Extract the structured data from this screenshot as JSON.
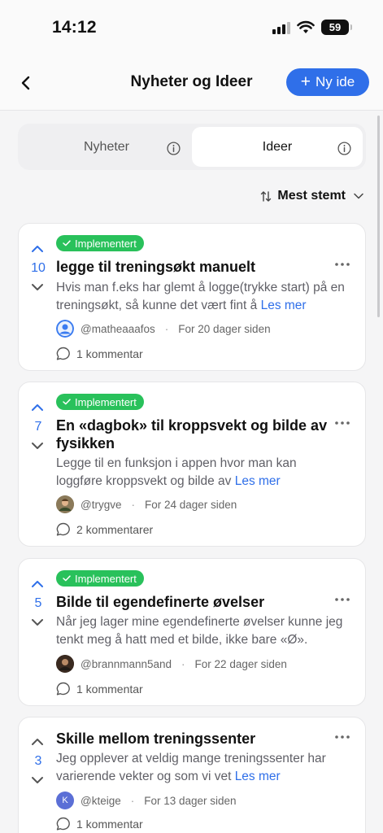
{
  "status": {
    "time": "14:12",
    "battery": "59"
  },
  "nav": {
    "title": "Nyheter og Ideer",
    "new_button": "Ny ide"
  },
  "tabs": [
    {
      "label": "Nyheter"
    },
    {
      "label": "Ideer"
    }
  ],
  "sort": {
    "label": "Mest stemt"
  },
  "badge": {
    "label": "Implementert",
    "color": "#29c15b"
  },
  "accent": "#2f6fe9",
  "read_more": "Les mer",
  "ideas": [
    {
      "votes": "10",
      "implemented": true,
      "title": "legge til treningsøkt manuelt",
      "description": "Hvis man f.eks har glemt å logge(trykke start) på en treningsøkt, så kunne det vært fint å",
      "author": "@matheaaafos",
      "time": "For 20 dager siden",
      "comments": "1 kommentar"
    },
    {
      "votes": "7",
      "implemented": true,
      "title": "En «dagbok» til kroppsvekt og bilde av fysikken",
      "description": "Legge til en funksjon i appen hvor man kan loggføre kroppsvekt og bilde av",
      "author": "@trygve",
      "time": "For 24 dager siden",
      "comments": "2 kommentarer"
    },
    {
      "votes": "5",
      "implemented": true,
      "title": "Bilde til egendefinerte øvelser",
      "description": "Når jeg lager mine egendefinerte øvelser kunne jeg tenkt meg å hatt med et bilde, ikke bare «Ø».",
      "author": "@brannmann5and",
      "time": "For 22 dager siden",
      "comments": "1 kommentar"
    },
    {
      "votes": "3",
      "implemented": false,
      "title": "Skille mellom treningssenter",
      "description": "Jeg opplever at veldig mange treningssenter har varierende vekter og som vi vet",
      "author": "@kteige",
      "author_initial": "K",
      "time": "For 13 dager siden",
      "comments": "1 kommentar"
    }
  ]
}
